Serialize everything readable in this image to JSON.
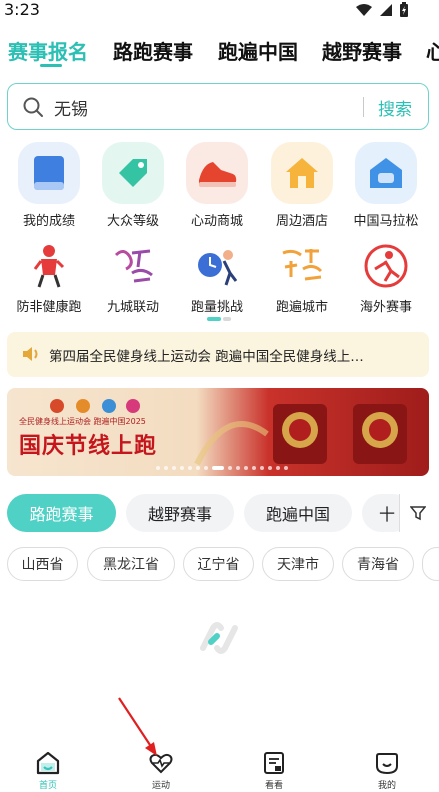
{
  "status": {
    "time": "3:23"
  },
  "top_tabs": [
    {
      "label": "赛事报名",
      "active": true
    },
    {
      "label": "路跑赛事",
      "active": false
    },
    {
      "label": "跑遍中国",
      "active": false
    },
    {
      "label": "越野赛事",
      "active": false
    },
    {
      "label": "心",
      "active": false
    }
  ],
  "search": {
    "value": "无锡",
    "button": "搜索"
  },
  "grid_row1": [
    {
      "label": "我的成绩",
      "icon": "book-icon"
    },
    {
      "label": "大众等级",
      "icon": "tag-icon"
    },
    {
      "label": "心动商城",
      "icon": "sneaker-icon"
    },
    {
      "label": "周边酒店",
      "icon": "house-icon"
    },
    {
      "label": "中国马拉松",
      "icon": "chat-house-icon"
    }
  ],
  "grid_row2": [
    {
      "label": "防非健康跑",
      "icon": "runner-icon"
    },
    {
      "label": "九城联动",
      "icon": "nine-cities-icon"
    },
    {
      "label": "跑量挑战",
      "icon": "clock-runner-icon"
    },
    {
      "label": "跑遍城市",
      "icon": "city-icon"
    },
    {
      "label": "海外赛事",
      "icon": "overseas-run-icon"
    }
  ],
  "notice": {
    "text": "第四届全民健身线上运动会 跑遍中国全民健身线上…"
  },
  "banner": {
    "subtitle": "全民健身线上运动会 跑遍中国2025",
    "title": "国庆节线上跑"
  },
  "category_tabs": [
    {
      "label": "路跑赛事",
      "active": true
    },
    {
      "label": "越野赛事",
      "active": false
    },
    {
      "label": "跑遍中国",
      "active": false
    },
    {
      "label": "十",
      "active": false
    }
  ],
  "provinces": [
    "山西省",
    "黑龙江省",
    "辽宁省",
    "天津市",
    "青海省"
  ],
  "bottom_nav": [
    {
      "label": "首页",
      "icon": "home-icon",
      "active": true
    },
    {
      "label": "运动",
      "icon": "heart-pulse-icon",
      "active": false
    },
    {
      "label": "看看",
      "icon": "article-icon",
      "active": false
    },
    {
      "label": "我的",
      "icon": "smile-icon",
      "active": false
    }
  ],
  "colors": {
    "accent": "#2cbfb4",
    "notice_bg": "#fbf4de",
    "annotation_arrow": "#e02020"
  }
}
